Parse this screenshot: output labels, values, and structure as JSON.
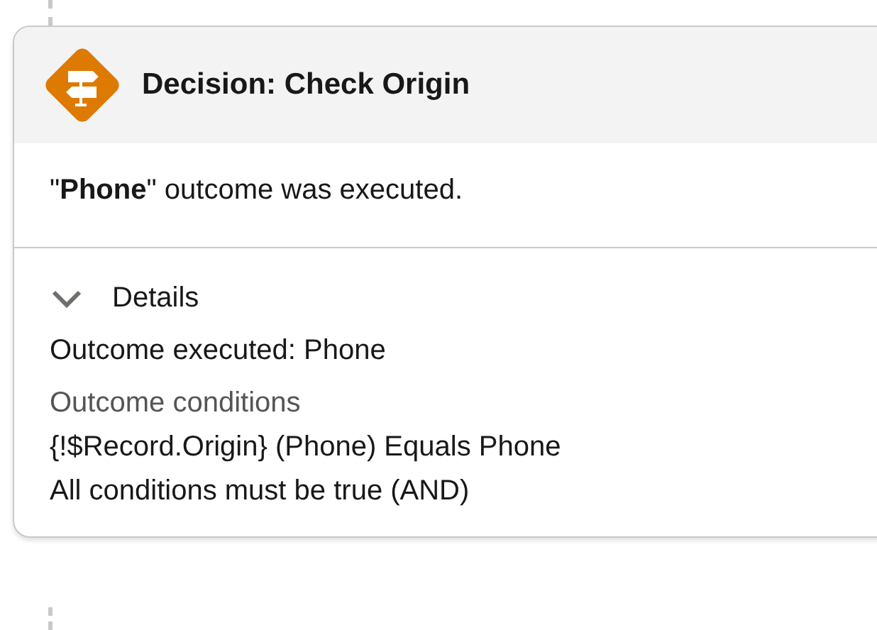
{
  "card": {
    "title": "Decision: Check Origin",
    "summary": "\"**Phone**\" outcome was executed.",
    "details": {
      "label": "Details",
      "expanded": true,
      "outcome": "Outcome executed: Phone",
      "conditions_heading": "Outcome conditions",
      "conditions": [
        "{!$Record.Origin} (Phone) Equals Phone"
      ],
      "logic": "All conditions must be true (AND)"
    }
  }
}
